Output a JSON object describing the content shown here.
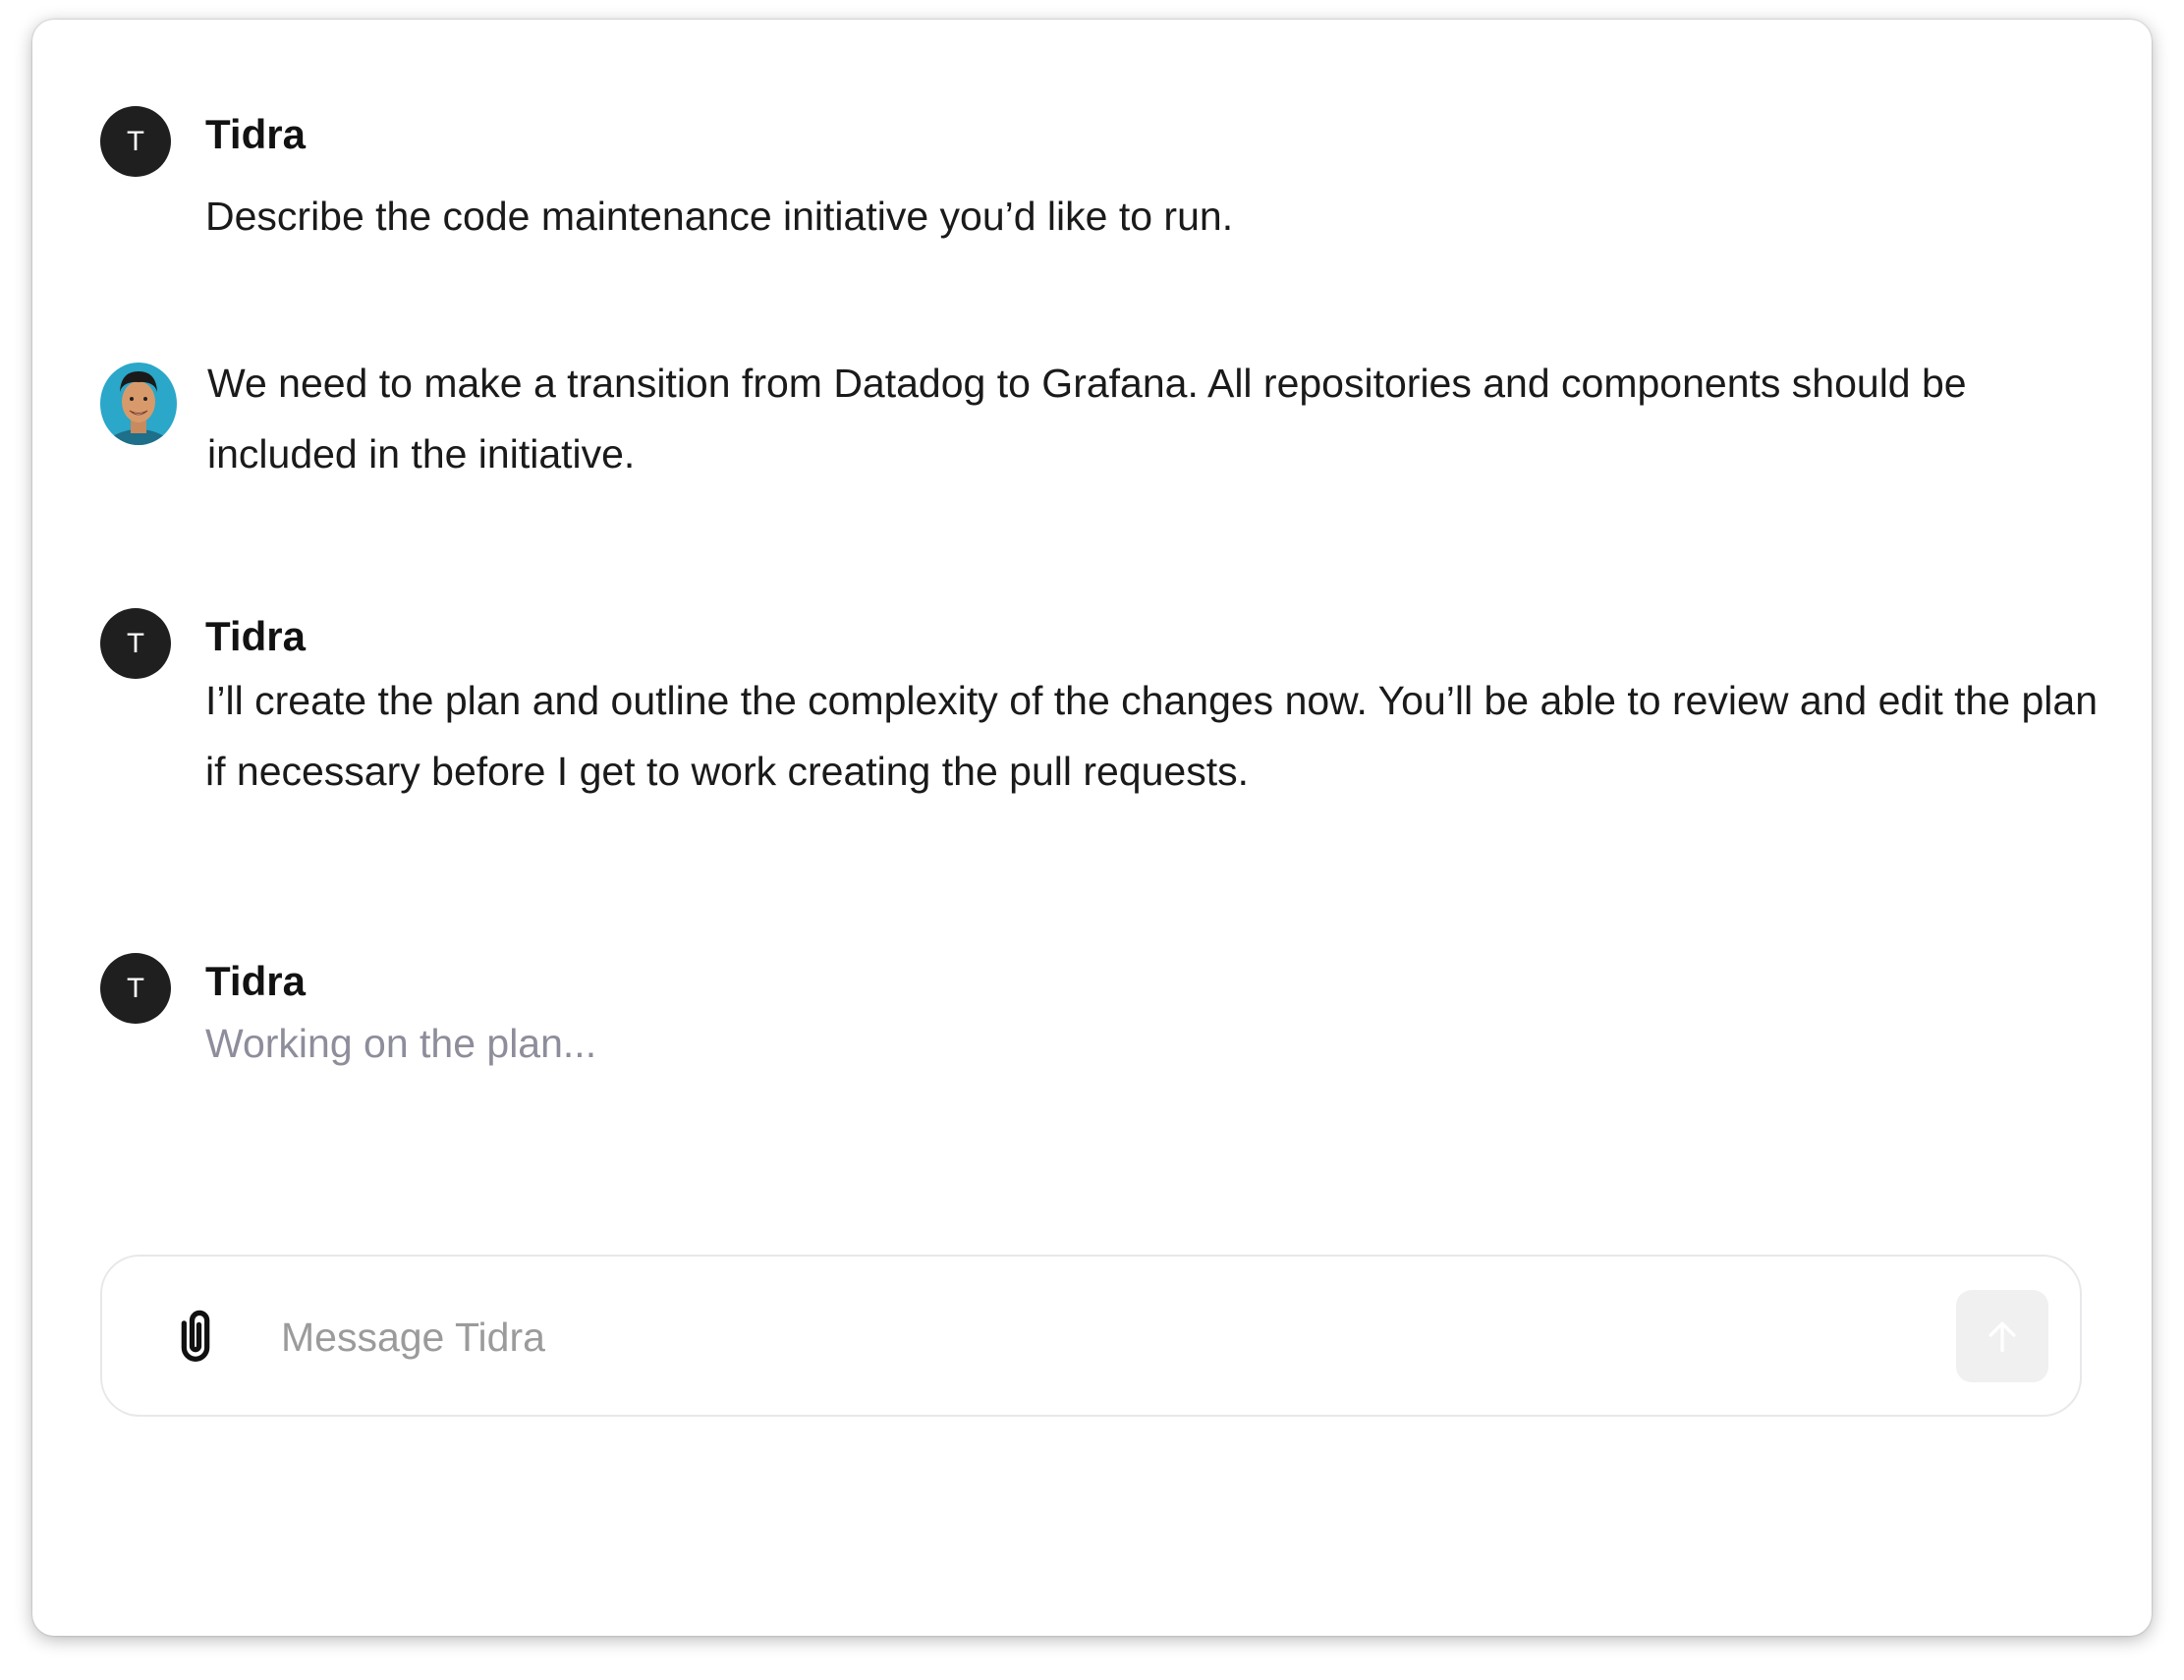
{
  "conversation": {
    "messages": [
      {
        "role": "assistant",
        "avatar_letter": "T",
        "author": "Tidra",
        "text": "Describe the code maintenance initiative you’d like to run."
      },
      {
        "role": "user",
        "avatar": "user-photo",
        "text": "We need to make a transition from Datadog to Grafana. All repositories and components should be included in the initiative."
      },
      {
        "role": "assistant",
        "avatar_letter": "T",
        "author": "Tidra",
        "text": "I’ll create the plan and outline the complexity of the changes now. You’ll be able to review and edit the plan if necessary before I get to work creating the pull requests."
      },
      {
        "role": "assistant",
        "avatar_letter": "T",
        "author": "Tidra",
        "text": "Working on the plan...",
        "status": "pending"
      }
    ]
  },
  "composer": {
    "placeholder": "Message Tidra",
    "value": "",
    "attach_icon": "paperclip-icon",
    "send_icon": "arrow-up-icon",
    "send_enabled": false
  },
  "colors": {
    "avatar_bg": "#1f1f1f",
    "pending_text": "#8d8d9b",
    "send_button_bg": "#f0f0f0",
    "user_avatar_bg": "#2aa7c9"
  }
}
